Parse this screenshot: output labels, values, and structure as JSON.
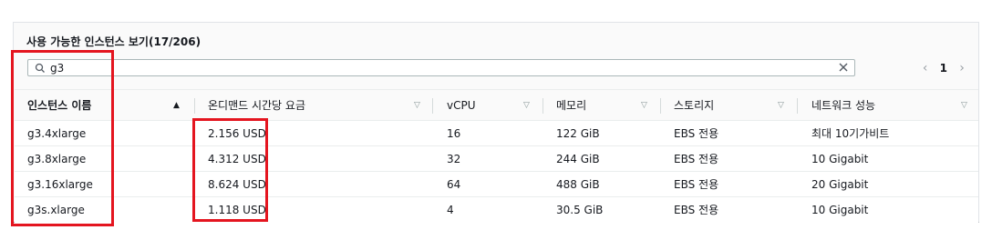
{
  "panel": {
    "title": "사용 가능한 인스턴스 보기",
    "count": "(17/206)"
  },
  "search": {
    "value": "g3",
    "icon": "search-icon",
    "clear_icon": "close-icon"
  },
  "pagination": {
    "prev": "‹",
    "page": "1",
    "next": "›"
  },
  "columns": [
    {
      "label": "인스턴스 이름",
      "sort": "▲",
      "sorted": true
    },
    {
      "label": "온디맨드 시간당 요금",
      "sort": "▽",
      "sorted": false
    },
    {
      "label": "vCPU",
      "sort": "▽",
      "sorted": false
    },
    {
      "label": "메모리",
      "sort": "▽",
      "sorted": false
    },
    {
      "label": "스토리지",
      "sort": "▽",
      "sorted": false
    },
    {
      "label": "네트워크 성능",
      "sort": "▽",
      "sorted": false
    }
  ],
  "rows": [
    {
      "name": "g3.4xlarge",
      "price": "2.156 USD",
      "vcpu": "16",
      "memory": "122 GiB",
      "storage": "EBS 전용",
      "network": "최대 10기가비트"
    },
    {
      "name": "g3.8xlarge",
      "price": "4.312 USD",
      "vcpu": "32",
      "memory": "244 GiB",
      "storage": "EBS 전용",
      "network": "10 Gigabit"
    },
    {
      "name": "g3.16xlarge",
      "price": "8.624 USD",
      "vcpu": "64",
      "memory": "488 GiB",
      "storage": "EBS 전용",
      "network": "20 Gigabit"
    },
    {
      "name": "g3s.xlarge",
      "price": "1.118 USD",
      "vcpu": "4",
      "memory": "30.5 GiB",
      "storage": "EBS 전용",
      "network": "10 Gigabit"
    }
  ],
  "colors": {
    "highlight": "#e4151f",
    "border": "#eaeded"
  }
}
